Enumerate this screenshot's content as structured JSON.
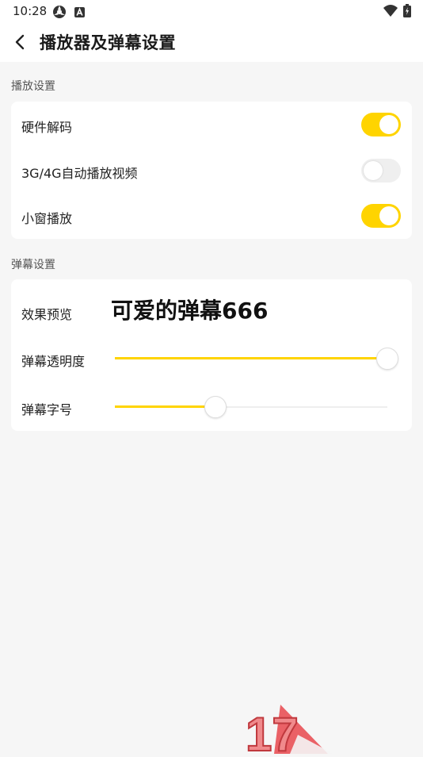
{
  "status_bar": {
    "time": "10:28"
  },
  "header": {
    "title": "播放器及弹幕设置",
    "back_icon": "chevron-left-icon"
  },
  "playback_section": {
    "label": "播放设置",
    "items": [
      {
        "label": "硬件解码",
        "enabled": true
      },
      {
        "label": "3G/4G自动播放视频",
        "enabled": false
      },
      {
        "label": "小窗播放",
        "enabled": true
      }
    ]
  },
  "danmaku_section": {
    "label": "弹幕设置",
    "preview_label": "效果预览",
    "preview_text": "可爱的弹幕666",
    "opacity_label": "弹幕透明度",
    "opacity_value": 1.0,
    "font_size_label": "弹幕字号",
    "font_size_value": 0.37
  },
  "watermark": {
    "text": "17"
  },
  "colors": {
    "accent": "#ffd400",
    "background": "#f6f6f6",
    "card": "#ffffff",
    "text_primary": "#222222",
    "text_secondary": "#555555"
  }
}
